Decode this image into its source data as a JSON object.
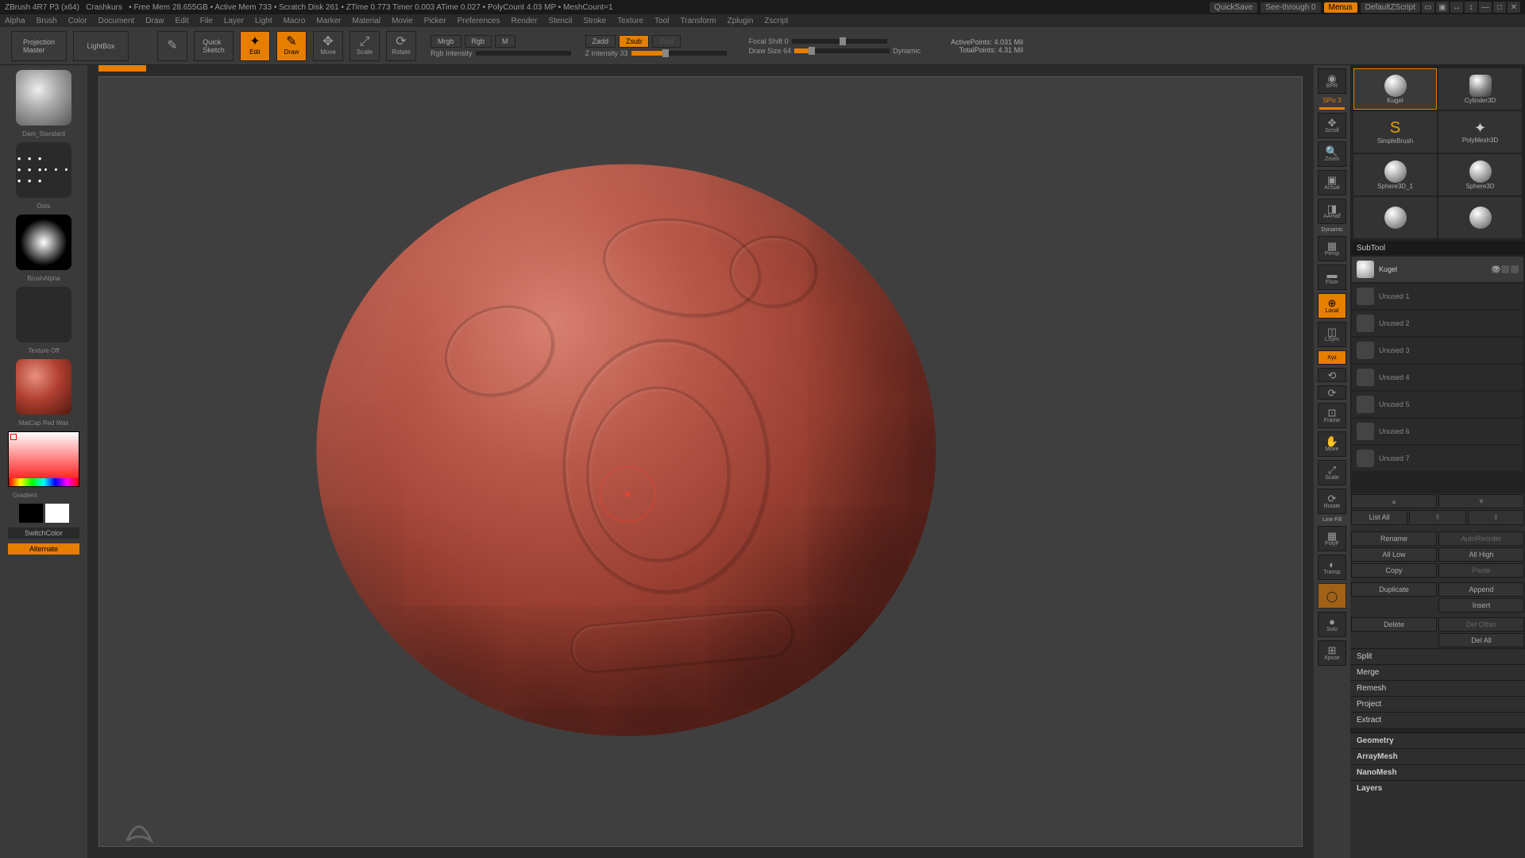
{
  "titlebar": {
    "app": "ZBrush 4R7 P3 (x64)",
    "doc": "Crashkurs",
    "stats": "• Free Mem 28.655GB • Active Mem 733 • Scratch Disk 261 • ZTime 0.773 Timer 0.003 ATime 0.027 • PolyCount 4.03 MP • MeshCount=1",
    "quicksave": "QuickSave",
    "seethrough": "See-through   0",
    "menus": "Menus",
    "script": "DefaultZScript"
  },
  "menubar": [
    "Alpha",
    "Brush",
    "Color",
    "Document",
    "Draw",
    "Edit",
    "File",
    "Layer",
    "Light",
    "Macro",
    "Marker",
    "Material",
    "Movie",
    "Picker",
    "Preferences",
    "Render",
    "Stencil",
    "Stroke",
    "Texture",
    "Tool",
    "Transform",
    "Zplugin",
    "Zscript"
  ],
  "toolbar": {
    "projection": "Projection\nMaster",
    "lightbox": "LightBox",
    "quicksketch": "Quick\nSketch",
    "edit": "Edit",
    "draw": "Draw",
    "move": "Move",
    "scale": "Scale",
    "rotate": "Rotate",
    "modes": {
      "mrgb": "Mrgb",
      "rgb": "Rgb",
      "m": "M",
      "zadd": "Zadd",
      "zsub": "Zsub",
      "zcut": "Zcut"
    },
    "rgb_int_label": "Rgb Intensity",
    "z_int_label": "Z Intensity 33",
    "focal_label": "Focal Shift 0",
    "draw_size_label": "Draw Size 64",
    "dynamic": "Dynamic",
    "active_pts": "ActivePoints: 4.031 Mil",
    "total_pts": "TotalPoints: 4.31 Mil"
  },
  "left": {
    "brush_name": "Dam_Standard",
    "stroke_name": "Dots",
    "alpha_name": "BrushAlpha",
    "texture_name": "Texture Off",
    "material_name": "MatCap Red Wax",
    "gradient": "Gradient",
    "switchcolor": "SwitchColor",
    "alternate": "Alternate"
  },
  "shelf": {
    "spix": "SPix 3",
    "items": [
      "BPR",
      "Scroll",
      "Zoom",
      "Actual",
      "AAHalf",
      "Persp",
      "Floor",
      "Local",
      "LSym",
      "Xyz",
      "",
      "",
      "Frame",
      "Move",
      "Scale",
      "Rotate",
      "PolyF",
      "Transp",
      "Ghost",
      "Solo",
      "Xpose"
    ],
    "line_fill": "Line Fill"
  },
  "tools": {
    "row1": [
      "Kugel",
      "Cylinder3D"
    ],
    "row2": [
      "SimpleBrush",
      "PolyMesh3D"
    ],
    "row3": [
      "Sphere3D_1",
      "Sphere3D"
    ],
    "row4": [
      "",
      ""
    ]
  },
  "subtool": {
    "header": "SubTool",
    "active_name": "Kugel",
    "slots": [
      "Unused 1",
      "Unused 2",
      "Unused 3",
      "Unused 4",
      "Unused 5",
      "Unused 6",
      "Unused 7"
    ],
    "list_all": "List All",
    "rename": "Rename",
    "autoreorder": "AutoReorder",
    "all_low": "All Low",
    "all_high": "All High",
    "copy": "Copy",
    "paste": "Paste",
    "duplicate": "Duplicate",
    "append": "Append",
    "insert": "Insert",
    "delete": "Delete",
    "del_other": "Del Other",
    "del_all": "Del All",
    "split": "Split",
    "merge": "Merge",
    "remesh": "Remesh",
    "project": "Project",
    "extract": "Extract",
    "geometry": "Geometry",
    "arraymesh": "ArrayMesh",
    "nanomesh": "NanoMesh",
    "layers": "Layers"
  }
}
